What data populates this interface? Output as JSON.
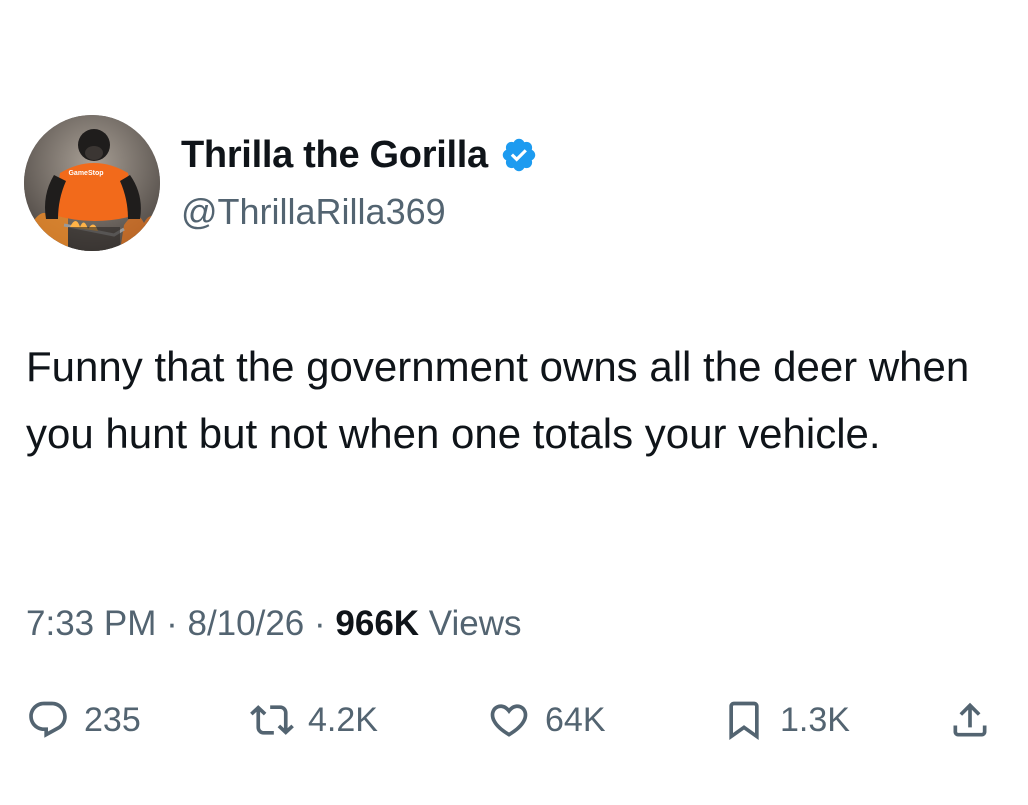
{
  "author": {
    "display_name": "Thrilla the Gorilla",
    "handle": "@ThrillaRilla369",
    "verified": true,
    "avatar_shirt_text": "GameStop"
  },
  "tweet": {
    "text": "Funny that the government owns all the deer when you hunt but not when one totals your vehicle."
  },
  "meta": {
    "time": "7:33 PM",
    "separator": "·",
    "date": "8/10/26",
    "views_count": "966K",
    "views_label": "Views"
  },
  "actions": {
    "replies": "235",
    "retweets": "4.2K",
    "likes": "64K",
    "bookmarks": "1.3K"
  },
  "colors": {
    "text": "#0f1419",
    "secondary": "#536471",
    "verified": "#1d9bf0",
    "shirt": "#f26a1b"
  },
  "icons": [
    "verified-badge-icon",
    "reply-icon",
    "retweet-icon",
    "like-icon",
    "bookmark-icon",
    "share-icon"
  ]
}
